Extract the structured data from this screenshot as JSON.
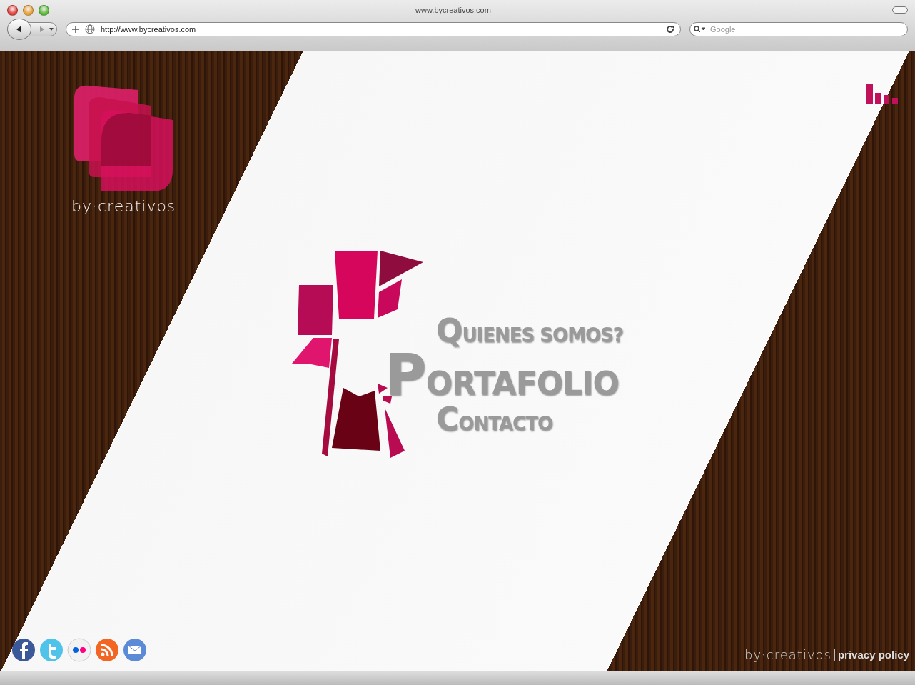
{
  "browser": {
    "title": "www.bycreativos.com",
    "url": "http://www.bycreativos.com",
    "search_placeholder": "Google"
  },
  "logo": {
    "wordmark": "by·creativos"
  },
  "menu": [
    {
      "label": "QUIENES SOMOS?",
      "kind": "minor"
    },
    {
      "label": "PORTAFOLIO",
      "kind": "major"
    },
    {
      "label": "CONTACTO",
      "kind": "minor"
    }
  ],
  "social": [
    {
      "kind": "facebook"
    },
    {
      "kind": "twitter"
    },
    {
      "kind": "flickr"
    },
    {
      "kind": "rss"
    },
    {
      "kind": "mail"
    }
  ],
  "footer": {
    "wordmark": "by·creativos",
    "link": "privacy policy"
  }
}
